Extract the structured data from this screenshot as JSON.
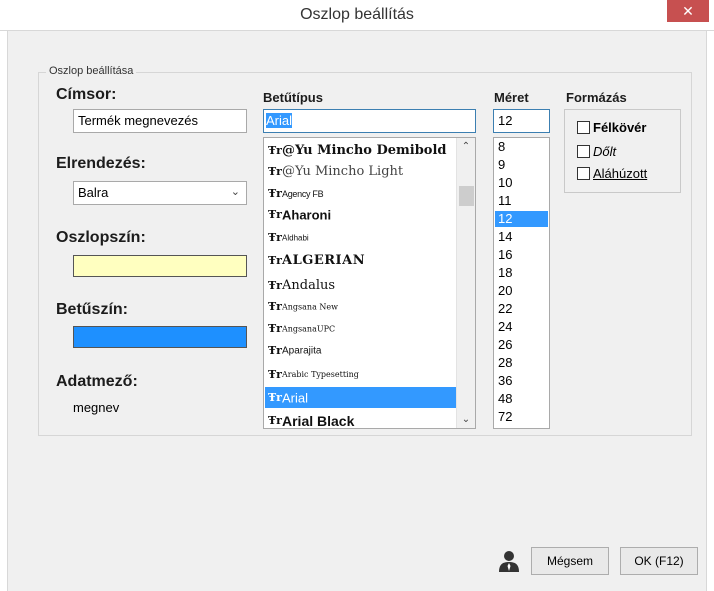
{
  "window": {
    "title": "Oszlop beállítás",
    "close_glyph": "✕"
  },
  "group": {
    "legend": "Oszlop beállítása"
  },
  "left": {
    "cimsor_label": "Címsor:",
    "cimsor_value": "Termék megnevezés",
    "elrendezes_label": "Elrendezés:",
    "elrendezes_value": "Balra",
    "oszlopszin_label": "Oszlopszín:",
    "oszlopszin_color": "#ffffc0",
    "betuszin_label": "Betűszín:",
    "betuszin_color": "#1e90ff",
    "adatmezo_label": "Adatmező:",
    "adatmezo_value": "megnev"
  },
  "font": {
    "label": "Betűtípus",
    "value": "Arial",
    "icon": "truetype-font-icon",
    "items": [
      "@Yu Mincho Demibold",
      "@Yu Mincho Light",
      "Agency FB",
      "Aharoni",
      "Aldhabi",
      "ALGERIAN",
      "Andalus",
      "Angsana New",
      "AngsanaUPC",
      "Aparajita",
      "Arabic Typesetting",
      "Arial",
      "Arial Black"
    ],
    "selected": "Arial"
  },
  "size": {
    "label": "Méret",
    "value": "12",
    "items": [
      "8",
      "9",
      "10",
      "11",
      "12",
      "14",
      "16",
      "18",
      "20",
      "22",
      "24",
      "26",
      "28",
      "36",
      "48",
      "72"
    ],
    "selected": "12"
  },
  "format": {
    "label": "Formázás",
    "bold": "Félkövér",
    "italic": "Dőlt",
    "underline": "Aláhúzott"
  },
  "buttons": {
    "cancel": "Mégsem",
    "ok": "OK (F12)"
  },
  "colors": {
    "selection": "#3399ff",
    "close": "#c75050"
  }
}
